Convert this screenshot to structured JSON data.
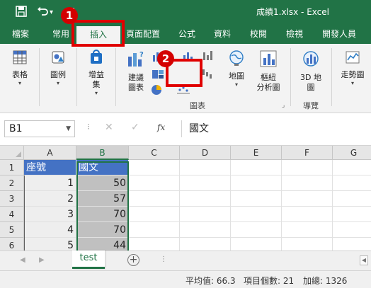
{
  "window": {
    "title": "成績1.xlsx  -  Excel",
    "qat": {
      "save": "save-icon",
      "undo": "undo-icon",
      "undo_more": "▾",
      "customize": "customize-icon"
    }
  },
  "ribbon": {
    "tabs": [
      {
        "label": "檔案",
        "active": false
      },
      {
        "label": "常用",
        "active": false
      },
      {
        "label": "插入",
        "active": true
      },
      {
        "label": "頁面配置",
        "active": false
      },
      {
        "label": "公式",
        "active": false
      },
      {
        "label": "資料",
        "active": false
      },
      {
        "label": "校閱",
        "active": false
      },
      {
        "label": "檢視",
        "active": false
      },
      {
        "label": "開發人員",
        "active": false
      }
    ],
    "buttons": {
      "table": "表格",
      "illustrations": "圖例",
      "addins_line1": "增益",
      "addins_line2": "集",
      "recommended_line1": "建議",
      "recommended_line2": "圖表",
      "maps": "地圖",
      "pivotchart_line1": "樞紐",
      "pivotchart_line2": "分析圖",
      "map3d_line1": "3D 地",
      "map3d_line2": "圖",
      "sparkline": "走勢圖"
    },
    "groups": {
      "charts": "圖表",
      "tours": "導覽"
    }
  },
  "formula_bar": {
    "name_box": "B1",
    "fx": "fx",
    "content": "國文"
  },
  "sheet": {
    "columns": [
      "A",
      "B",
      "C",
      "D",
      "E",
      "F",
      "G"
    ],
    "selected_column": "B",
    "rows": [
      {
        "row": "1",
        "a": "座號",
        "b": "國文"
      },
      {
        "row": "2",
        "a": "1",
        "b": "50"
      },
      {
        "row": "3",
        "a": "2",
        "b": "57"
      },
      {
        "row": "4",
        "a": "3",
        "b": "70"
      },
      {
        "row": "5",
        "a": "4",
        "b": "70"
      },
      {
        "row": "6",
        "a": "5",
        "b": "44"
      }
    ],
    "header_fill": "#4472c4"
  },
  "sheet_tabs": {
    "active": "test",
    "add": "+"
  },
  "status_bar": {
    "average": "平均值: 66.3",
    "count": "項目個數: 21",
    "sum": "加總: 1326"
  },
  "callouts": [
    {
      "number": "1",
      "color": "#d40000"
    },
    {
      "number": "2",
      "color": "#d40000"
    }
  ],
  "colors": {
    "excel_green": "#217346",
    "highlight_red": "#e00000"
  }
}
